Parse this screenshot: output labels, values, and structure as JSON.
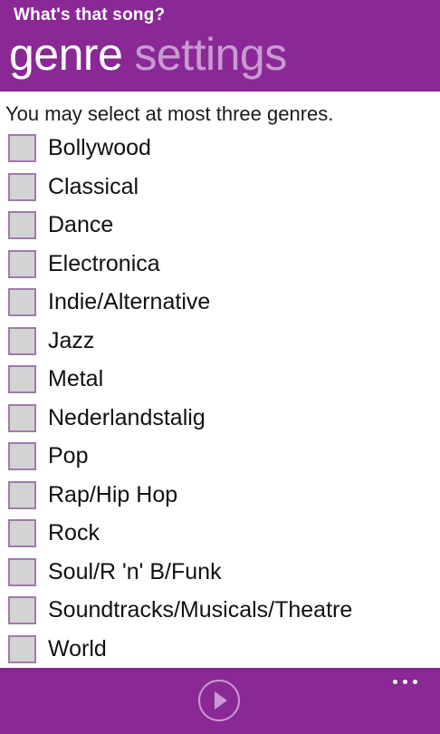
{
  "header": {
    "app_title": "What's that song?",
    "pivot": {
      "active": "genre",
      "inactive": "settings"
    }
  },
  "main": {
    "instruction": "You may select at most three genres.",
    "genres": [
      {
        "label": "Bollywood",
        "checked": false
      },
      {
        "label": "Classical",
        "checked": false
      },
      {
        "label": "Dance",
        "checked": false
      },
      {
        "label": "Electronica",
        "checked": false
      },
      {
        "label": "Indie/Alternative",
        "checked": false
      },
      {
        "label": "Jazz",
        "checked": false
      },
      {
        "label": "Metal",
        "checked": false
      },
      {
        "label": "Nederlandstalig",
        "checked": false
      },
      {
        "label": "Pop",
        "checked": false
      },
      {
        "label": "Rap/Hip Hop",
        "checked": false
      },
      {
        "label": "Rock",
        "checked": false
      },
      {
        "label": "Soul/R 'n' B/Funk",
        "checked": false
      },
      {
        "label": "Soundtracks/Musicals/Theatre",
        "checked": false
      },
      {
        "label": "World",
        "checked": false
      }
    ]
  },
  "appbar": {
    "play_icon": "play-icon",
    "more_icon": "more-ellipsis-icon"
  },
  "colors": {
    "accent": "#8A2896",
    "inactive_pivot": "#C99AD2",
    "checkbox_fill": "#D3D3D3"
  }
}
